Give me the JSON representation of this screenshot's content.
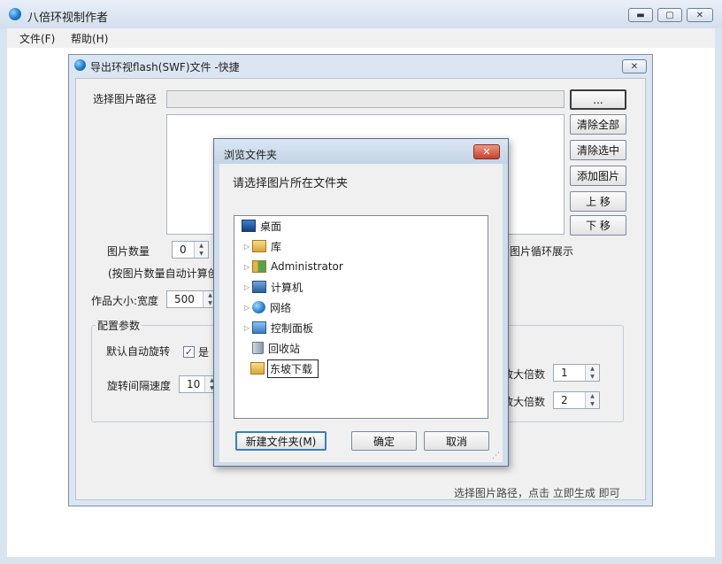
{
  "app": {
    "title": "八倍环视制作者",
    "menu": [
      {
        "label": "文件(F)"
      },
      {
        "label": "帮助(H)"
      }
    ],
    "buttons": {
      "minimize": "▬",
      "maximize": "▢",
      "close": "✕"
    }
  },
  "child": {
    "title": "导出环视flash(SWF)文件 -快捷",
    "path_label": "选择图片路径",
    "browse_label": "...",
    "side_buttons": [
      "清除全部",
      "清除选中",
      "添加图片",
      "上 移",
      "下 移"
    ],
    "image_count_label": "图片数量",
    "image_count_value": "0",
    "auto_calc_note": "(按图片数量自动计算创",
    "loop_label": "图片循环展示",
    "size_label": "作品大小:宽度",
    "width_value": "500",
    "config_label": "配置参数",
    "auto_rotate_label": "默认自动旋转",
    "auto_rotate_yes": "是",
    "rotate_speed_label": "旋转间隔速度",
    "rotate_speed_value": "10",
    "zoom_label_1": "放大倍数",
    "zoom_value_1": "1",
    "zoom_label_2": "放大倍数",
    "zoom_value_2": "2",
    "footer_hint": "选择图片路径，点击 立即生成 即可"
  },
  "dialog": {
    "title": "浏览文件夹",
    "prompt": "请选择图片所在文件夹",
    "tree": [
      {
        "label": "桌面",
        "icon": "desktop-icon"
      },
      {
        "label": "库",
        "icon": "library-icon"
      },
      {
        "label": "Administrator",
        "icon": "user-folder-icon"
      },
      {
        "label": "计算机",
        "icon": "computer-icon"
      },
      {
        "label": "网络",
        "icon": "network-icon"
      },
      {
        "label": "控制面板",
        "icon": "control-panel-icon"
      },
      {
        "label": "回收站",
        "icon": "recycle-bin-icon"
      },
      {
        "label": "东坡下载",
        "icon": "folder-icon"
      }
    ],
    "new_folder_label": "新建文件夹(M)",
    "ok_label": "确定",
    "cancel_label": "取消"
  }
}
